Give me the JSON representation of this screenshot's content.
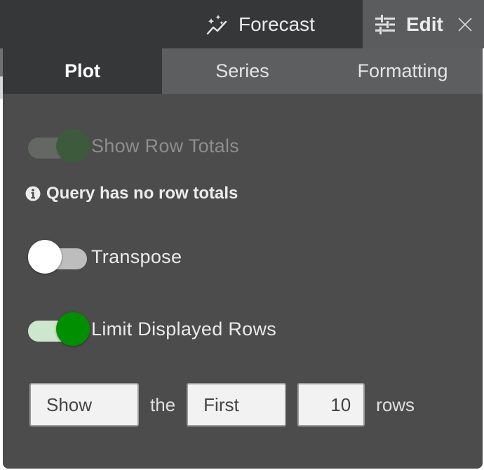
{
  "header": {
    "forecast_label": "Forecast",
    "edit_label": "Edit"
  },
  "tabs": [
    {
      "label": "Plot",
      "active": true
    },
    {
      "label": "Series",
      "active": false
    },
    {
      "label": "Formatting",
      "active": false
    }
  ],
  "settings": {
    "show_row_totals": {
      "label": "Show Row Totals",
      "enabled": false,
      "on": true
    },
    "info_message": "Query has no row totals",
    "transpose": {
      "label": "Transpose",
      "on": false
    },
    "limit_displayed_rows": {
      "label": "Limit Displayed Rows",
      "on": true
    }
  },
  "limit": {
    "mode": "Show",
    "word_the": "the",
    "position": "First",
    "count": "10",
    "word_rows": "rows"
  },
  "colors": {
    "accent_green": "#008f00",
    "panel_bg": "#4b4c4b",
    "header_bg": "#363739"
  }
}
